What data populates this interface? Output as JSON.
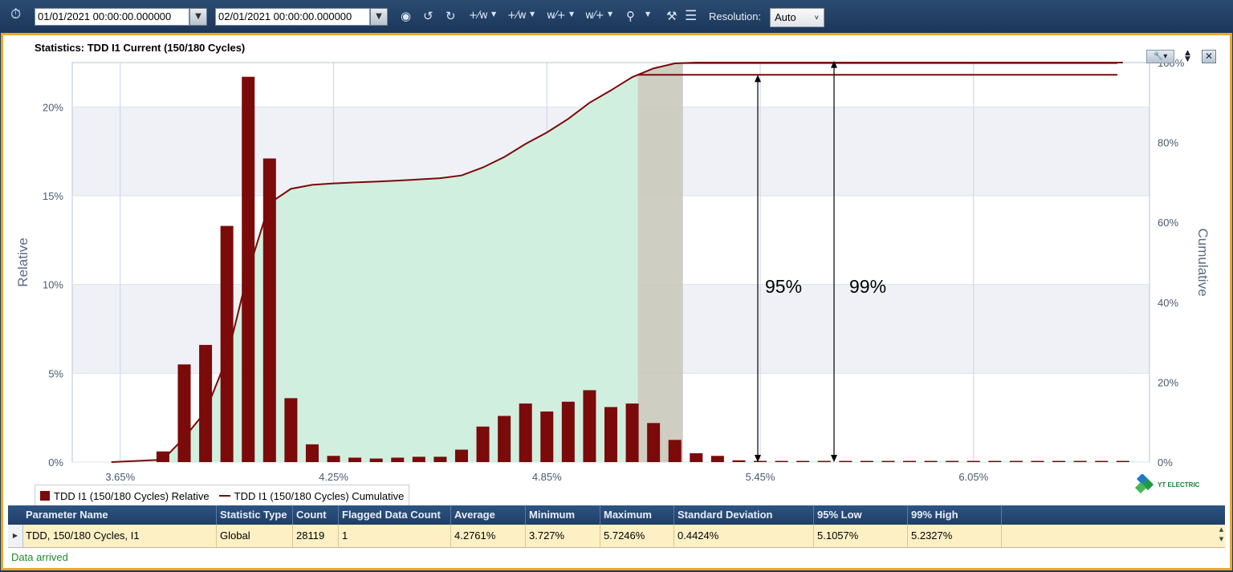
{
  "toolbar": {
    "start_date": "01/01/2021 00:00:00.000000",
    "end_date": "02/01/2021 00:00:00.000000",
    "resolution_label": "Resolution:",
    "resolution_value": "Auto",
    "icons": [
      "timer-icon",
      "play-icon",
      "rewind-icon",
      "forward-icon",
      "waveform-icon",
      "zoom-icon",
      "wrench-icon",
      "list-icon"
    ]
  },
  "chart": {
    "title": "Statistics: TDD I1 Current (150/180 Cycles)",
    "annotation_95": "95%",
    "annotation_99": "99%",
    "colors": {
      "bar": "#7b0a0a",
      "line": "#7b0a0a",
      "fill": "#cdeedd",
      "band": "#c9c9bb"
    }
  },
  "chart_data": {
    "type": "bar",
    "title": "Statistics: TDD I1 Current (150/180 Cycles)",
    "xlabel": "",
    "ylabel": "Relative",
    "y2label": "Cumulative",
    "x_ticks": [
      "3.65%",
      "4.25%",
      "4.85%",
      "5.45%",
      "6.05%"
    ],
    "y_ticks": [
      "0%",
      "5%",
      "10%",
      "15%",
      "20%"
    ],
    "y2_ticks": [
      "0%",
      "20%",
      "40%",
      "60%",
      "80%",
      "100%"
    ],
    "ylim": [
      0,
      22.5
    ],
    "y2lim": [
      0,
      100
    ],
    "xlim": [
      3.515,
      6.545
    ],
    "x": [
      3.77,
      3.83,
      3.89,
      3.95,
      4.01,
      4.07,
      4.13,
      4.19,
      4.25,
      4.31,
      4.37,
      4.43,
      4.49,
      4.55,
      4.61,
      4.67,
      4.73,
      4.79,
      4.85,
      4.91,
      4.97,
      5.03,
      5.09,
      5.15,
      5.21,
      5.27,
      5.33,
      5.39,
      5.45,
      5.51,
      5.57,
      5.63,
      5.69,
      5.75,
      5.81,
      5.87,
      5.93,
      5.99,
      6.05,
      6.11,
      6.17,
      6.23,
      6.29,
      6.35,
      6.41,
      6.47
    ],
    "series": [
      {
        "name": "TDD I1 (150/180 Cycles) Relative",
        "type": "bar",
        "values": [
          0.6,
          5.5,
          6.6,
          13.3,
          21.7,
          17.1,
          3.6,
          1.0,
          0.35,
          0.25,
          0.2,
          0.25,
          0.3,
          0.3,
          0.7,
          2.0,
          2.6,
          3.3,
          2.85,
          3.4,
          4.05,
          3.1,
          3.3,
          2.2,
          1.25,
          0.5,
          0.35,
          0.1,
          0.05,
          0.05,
          0.05,
          0.05,
          0.05,
          0.05,
          0.05,
          0.05,
          0.05,
          0.05,
          0.05,
          0.05,
          0.05,
          0.05,
          0.05,
          0.05,
          0.05,
          0.05
        ]
      },
      {
        "name": "TDD I1 (150/180 Cycles) Cumulative",
        "type": "line",
        "values": [
          0.6,
          6.1,
          12.7,
          26.0,
          47.7,
          64.8,
          68.4,
          69.4,
          69.75,
          70.0,
          70.2,
          70.45,
          70.75,
          71.05,
          71.75,
          73.75,
          76.35,
          79.65,
          82.5,
          85.9,
          89.95,
          93.05,
          96.35,
          98.55,
          99.8,
          100,
          100,
          100,
          100,
          100,
          100,
          100,
          100,
          100,
          100,
          100,
          100,
          100,
          100,
          100,
          100,
          100,
          100,
          100,
          100,
          100
        ]
      }
    ],
    "percentile_95_x": 5.1057,
    "percentile_99_x": 5.2327,
    "legend_position": "bottom-left",
    "grid": true
  },
  "legend": {
    "relative": "TDD I1 (150/180 Cycles) Relative",
    "cumulative": "TDD I1 (150/180 Cycles) Cumulative"
  },
  "logo_text": "YT ELECTRIC",
  "table": {
    "headers": [
      "Parameter Name",
      "Statistic Type",
      "Count",
      "Flagged Data Count",
      "Average",
      "Minimum",
      "Maximum",
      "Standard Deviation",
      "95% Low",
      "99% High"
    ],
    "rows": [
      [
        "TDD, 150/180 Cycles, I1",
        "Global",
        "28119",
        "1",
        "4.2761%",
        "3.727%",
        "5.7246%",
        "0.4424%",
        "5.1057%",
        "5.2327%"
      ]
    ]
  },
  "status": "Data arrived"
}
